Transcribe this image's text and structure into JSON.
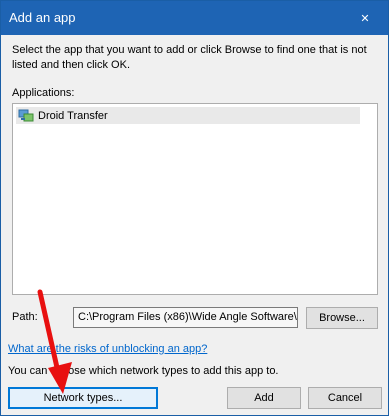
{
  "window": {
    "title": "Add an app",
    "close_glyph": "✕"
  },
  "instructions": "Select the app that you want to add or click Browse to find one that is not listed and then click OK.",
  "applications": {
    "label": "Applications:",
    "items": [
      {
        "name": "Droid Transfer",
        "icon": "network-app-icon"
      }
    ]
  },
  "path": {
    "label": "Path:",
    "value": "C:\\Program Files (x86)\\Wide Angle Software\\",
    "browse_label": "Browse..."
  },
  "risk_link": "What are the risks of unblocking an app?",
  "choose_text": "You can choose which network types to add this app to.",
  "buttons": {
    "network_types": "Network types...",
    "add": "Add",
    "cancel": "Cancel"
  },
  "colors": {
    "titlebar": "#1e64b4",
    "link": "#0066cc",
    "annotation_arrow": "#e81010"
  }
}
